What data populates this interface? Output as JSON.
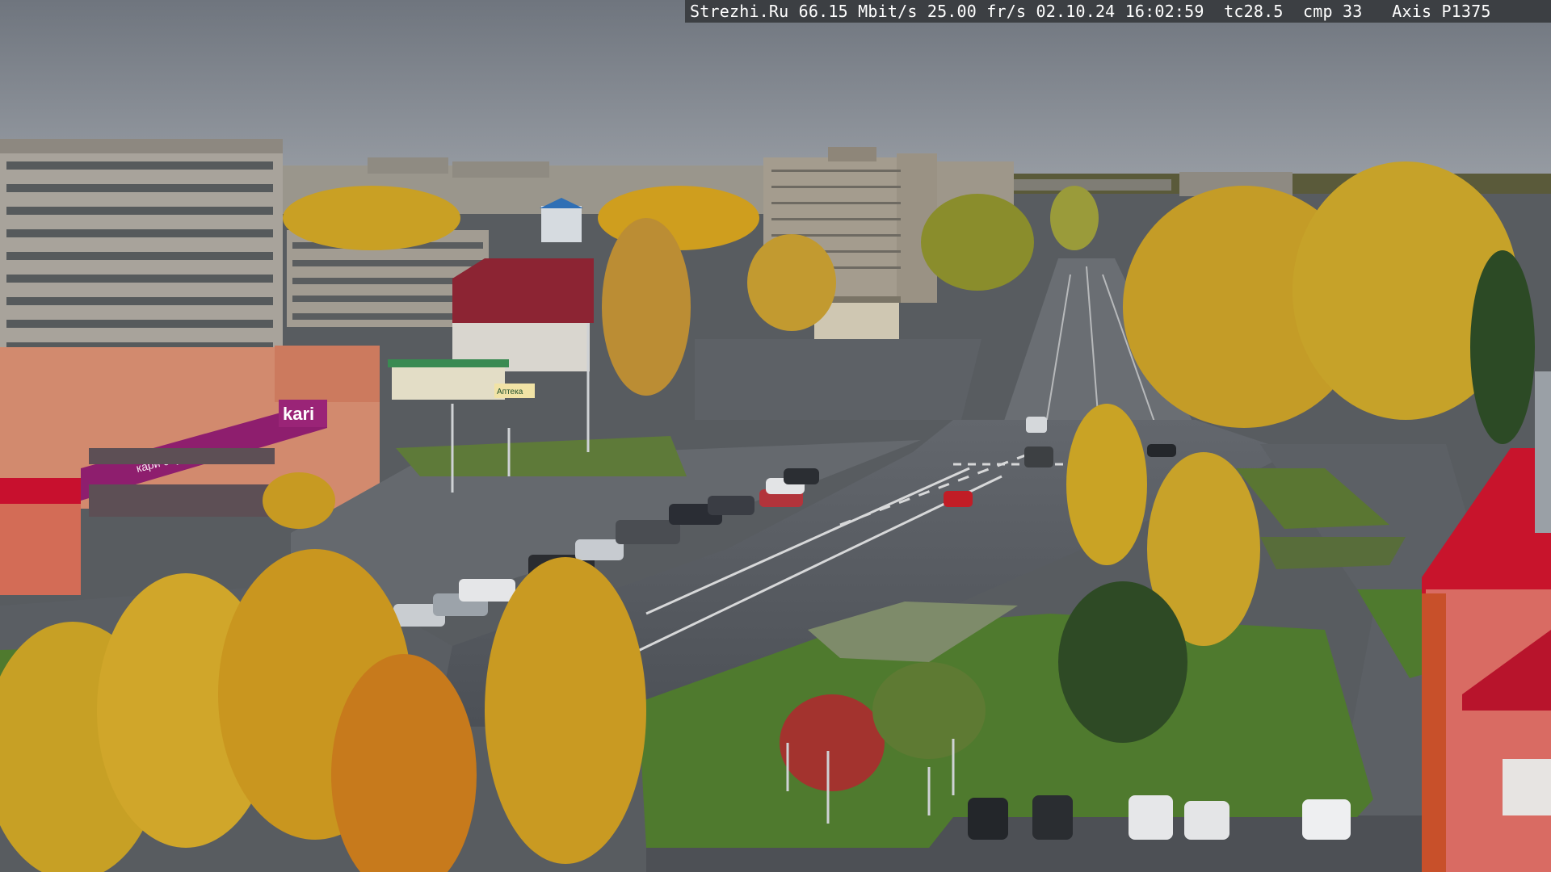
{
  "overlay": {
    "site": "Strezhi.Ru",
    "bitrate": "66.15 Mbit/s",
    "framerate": "25.00 fr/s",
    "date": "02.10.24",
    "time": "16:02:59",
    "tc": "tc28.5",
    "cmp": "cmp 33",
    "camera": "Axis P1375"
  },
  "signs": {
    "store_logo": "kari",
    "store_banner": "кари обувь",
    "pharmacy_sign": "Аптека"
  },
  "colors": {
    "sky": "#7d838c",
    "asphalt": "#55595f",
    "foliage_yellow": "#c9a024",
    "foliage_orange": "#c77a1c",
    "grass": "#4f7a2e",
    "magenta_banner": "#8e1e6e",
    "red_roof": "#b8142c"
  }
}
